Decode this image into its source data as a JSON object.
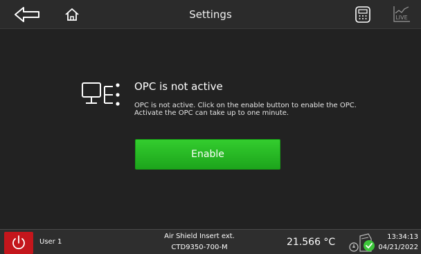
{
  "header": {
    "title": "Settings",
    "back_icon": "arrow-left-icon",
    "home_icon": "home-icon",
    "calculator_icon": "calculator-icon",
    "live_icon": "live-chart-icon",
    "live_label": "LIVE"
  },
  "message": {
    "icon": "opc-network-icon",
    "title": "OPC is not active",
    "line1": "OPC is not active. Click on the enable button to enable the OPC.",
    "line2": "Activate the OPC can take up to one minute.",
    "enable_label": "Enable"
  },
  "status_bar": {
    "power_icon": "power-icon",
    "user": "User 1",
    "sample_line1": "Air Shield Insert ext.",
    "sample_line2": "CTD9350-700-M",
    "temperature": "21.566 °C",
    "device_icon": "device-ok-icon",
    "time": "13:34:13",
    "date": "04/21/2022"
  },
  "colors": {
    "background": "#222222",
    "header": "#2b2b2b",
    "enable_green": "#22b21f",
    "power_red": "#c4161c",
    "status_ok": "#3cc63a"
  }
}
